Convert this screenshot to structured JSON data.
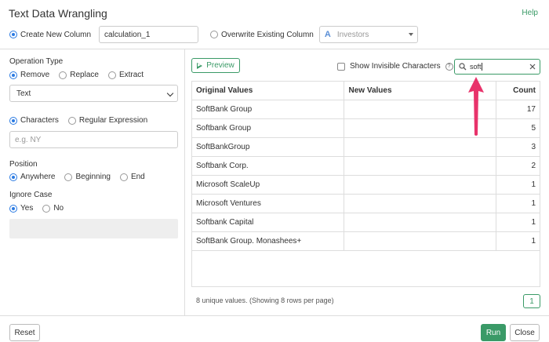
{
  "dialog": {
    "title": "Text Data Wrangling",
    "help": "Help"
  },
  "target": {
    "create_label": "Create New Column",
    "new_column_value": "calculation_1",
    "overwrite_label": "Overwrite Existing Column",
    "column_type_icon": "A",
    "column_select_value": "Investors"
  },
  "operation": {
    "heading": "Operation Type",
    "options": [
      "Remove",
      "Replace",
      "Extract"
    ],
    "selected": "Remove",
    "type_select": "Text"
  },
  "match": {
    "options": [
      "Characters",
      "Regular Expression"
    ],
    "input_placeholder": "e.g. NY"
  },
  "position": {
    "heading": "Position",
    "options": [
      "Anywhere",
      "Beginning",
      "End"
    ]
  },
  "ignore_case": {
    "heading": "Ignore Case",
    "options": [
      "Yes",
      "No"
    ]
  },
  "toolbar": {
    "preview_label": "Preview",
    "show_invisible_label": "Show Invisible Characters",
    "info_icon": "?",
    "search_value": "soft"
  },
  "table": {
    "headers": [
      "Original Values",
      "New Values",
      "Count"
    ],
    "rows": [
      [
        "SoftBank Group",
        "",
        "17"
      ],
      [
        "Softbank Group",
        "",
        "5"
      ],
      [
        "SoftBankGroup",
        "",
        "3"
      ],
      [
        "Softbank Corp.",
        "",
        "2"
      ],
      [
        "Microsoft ScaleUp",
        "",
        "1"
      ],
      [
        "Microsoft Ventures",
        "",
        "1"
      ],
      [
        "Softbank Capital",
        "",
        "1"
      ],
      [
        "SoftBank Group. Monashees+",
        "",
        "1"
      ]
    ]
  },
  "footer": {
    "summary": "8 unique values. (Showing 8 rows per page)",
    "page_number": "1",
    "reset_label": "Reset",
    "run_label": "Run",
    "close_label": "Close"
  },
  "colors": {
    "accent": "#3a9a67",
    "radio": "#2a7ae2",
    "arrow": "#e8336b"
  }
}
